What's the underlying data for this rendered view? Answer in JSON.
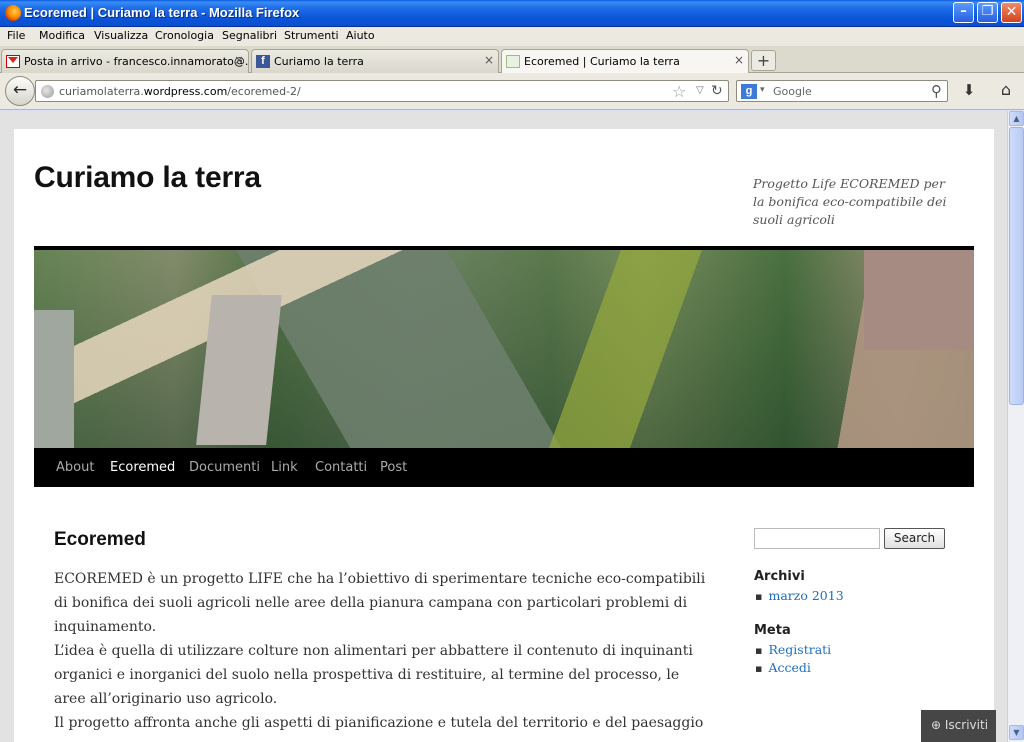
{
  "window": {
    "title": "Ecoremed | Curiamo la terra - Mozilla Firefox",
    "min_symbol": "–",
    "max_symbol": "❐",
    "close_symbol": "✕"
  },
  "menubar": {
    "items": [
      "File",
      "Modifica",
      "Visualizza",
      "Cronologia",
      "Segnalibri",
      "Strumenti",
      "Aiuto"
    ]
  },
  "tabs": [
    {
      "label": "Posta in arrivo - francesco.innamorato@...",
      "icon": "gmail-icon",
      "active": false,
      "close": "×"
    },
    {
      "label": "Curiamo la terra",
      "icon": "facebook-icon",
      "active": false,
      "close": "×"
    },
    {
      "label": "Ecoremed | Curiamo la terra",
      "icon": "ecoremed-favicon",
      "active": true,
      "close": "×"
    }
  ],
  "newtab_symbol": "+",
  "navbar": {
    "back_symbol": "←",
    "url_domain_prefix": "curiamolaterra.",
    "url_domain_main": "wordpress.com",
    "url_path": "/ecoremed-2/",
    "star_symbol": "☆",
    "dropdown_symbol": "▽",
    "reload_symbol": "↻",
    "search_engine_letter": "g",
    "search_engine_dd": "▾",
    "search_placeholder": "Google",
    "search_icon_symbol": "⚲",
    "download_symbol": "⬇",
    "home_symbol": "⌂"
  },
  "site": {
    "title": "Curiamo la terra",
    "description": "Progetto Life ECOREMED per la bonifica eco-compatibile dei suoli agricoli",
    "nav": [
      "About",
      "Ecoremed",
      "Documenti",
      "Link",
      "Contatti",
      "Post"
    ],
    "current_nav": "Ecoremed"
  },
  "post": {
    "title": "Ecoremed",
    "paragraphs": [
      "ECOREMED è un progetto LIFE che ha l’obiettivo di sperimentare tecniche eco-compatibili di bonifica dei suoli agricoli nelle aree della pianura campana con particolari problemi di inquinamento.",
      "L’idea è quella di utilizzare colture non alimentari per abbattere il contenuto di inquinanti organici e inorganici del suolo nella prospettiva di restituire, al termine del processo, le aree all’originario uso agricolo.",
      "Il progetto affronta anche gli aspetti di pianificazione e tutela del territorio e del paesaggio"
    ]
  },
  "sidebar": {
    "search_button": "Search",
    "search_value": "",
    "archives_title": "Archivi",
    "archives_items": [
      "marzo 2013"
    ],
    "meta_title": "Meta",
    "meta_items": [
      "Registrati",
      "Accedi"
    ]
  },
  "follow_button": {
    "icon": "⊕",
    "label": "Iscriviti"
  },
  "scrollbar": {
    "up": "▲",
    "down": "▼"
  },
  "colors": {
    "link": "#1b6ec2",
    "xp_title": "#0a55d8",
    "nav_bg": "#000000"
  }
}
